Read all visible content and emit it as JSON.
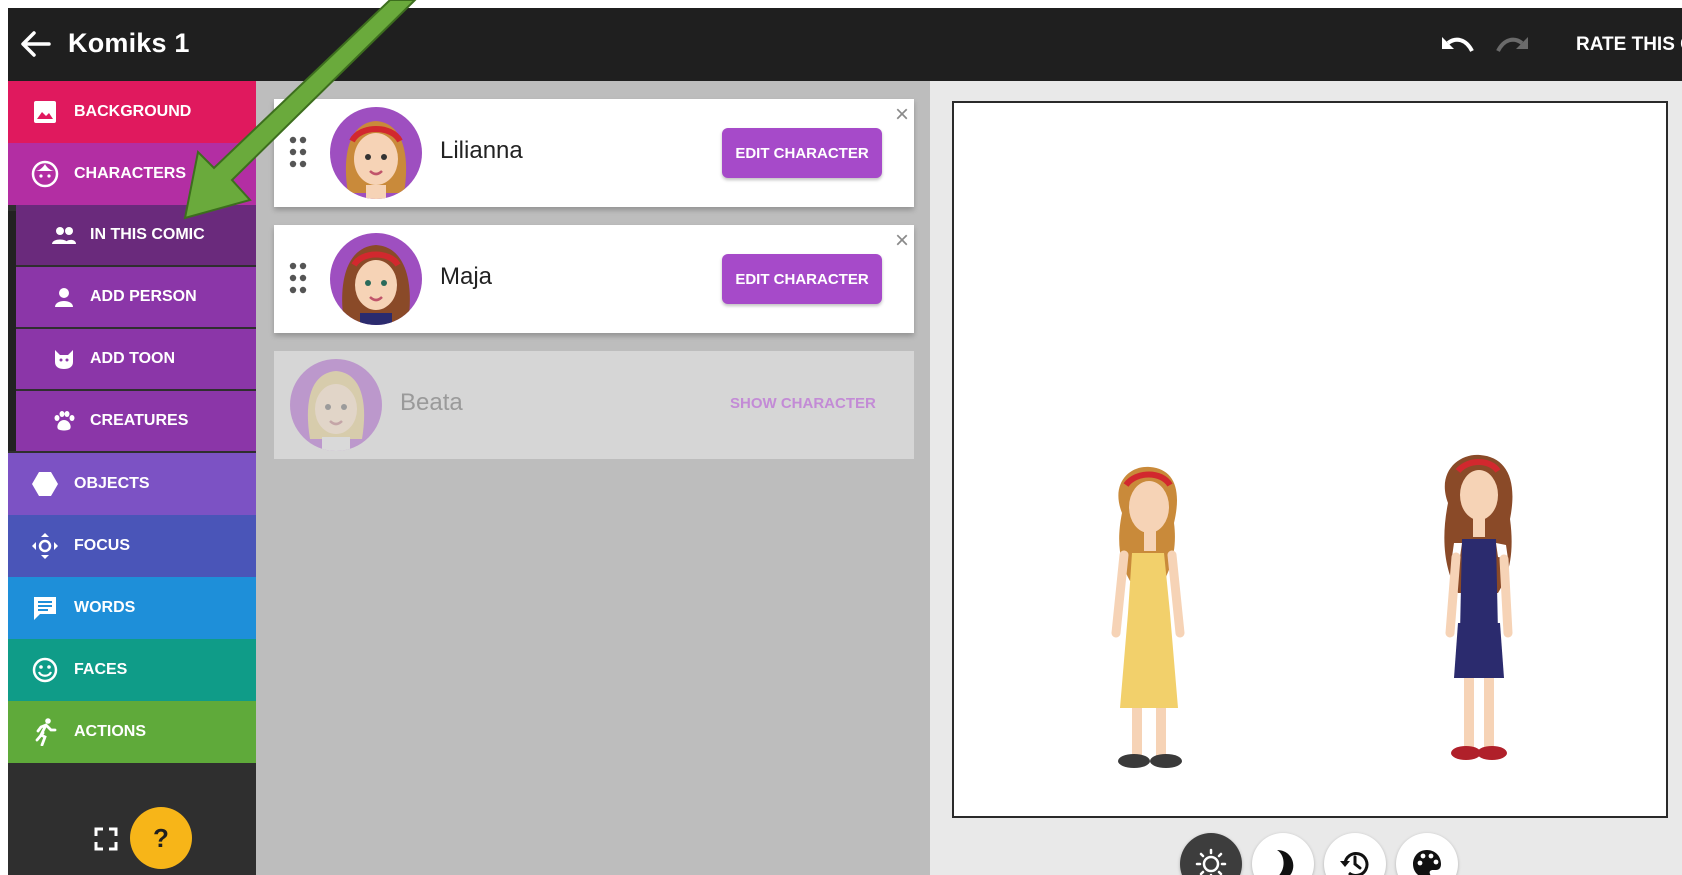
{
  "app": {
    "title": "Komiks 1",
    "rate_label": "RATE THIS COMIC"
  },
  "sidebar": {
    "items": [
      {
        "label": "BACKGROUND",
        "color": "#e0195e"
      },
      {
        "label": "CHARACTERS",
        "color": "#b32ea3"
      },
      {
        "label": "OBJECTS",
        "color": "#7c52c4"
      },
      {
        "label": "FOCUS",
        "color": "#4a55b8"
      },
      {
        "label": "WORDS",
        "color": "#1e8fd9"
      },
      {
        "label": "FACES",
        "color": "#0f9c88"
      },
      {
        "label": "ACTIONS",
        "color": "#5faa3a"
      }
    ],
    "subitems": [
      {
        "label": "IN THIS COMIC",
        "color": "#6a2a7c"
      },
      {
        "label": "ADD PERSON",
        "color": "#8b36a8"
      },
      {
        "label": "ADD TOON",
        "color": "#8b36a8"
      },
      {
        "label": "CREATURES",
        "color": "#8b36a8"
      }
    ],
    "help_label": "?"
  },
  "characters": [
    {
      "name": "Lilianna",
      "action": "EDIT CHARACTER",
      "hair": "#c98a3a"
    },
    {
      "name": "Maja",
      "action": "EDIT CHARACTER",
      "hair": "#8a4a28"
    },
    {
      "name": "Beata",
      "action": "SHOW CHARACTER",
      "hair": "#d9c07a"
    }
  ],
  "colors": {
    "accent": "#a64ac9",
    "help": "#f7b518",
    "arrow": "#6aaa3c"
  }
}
